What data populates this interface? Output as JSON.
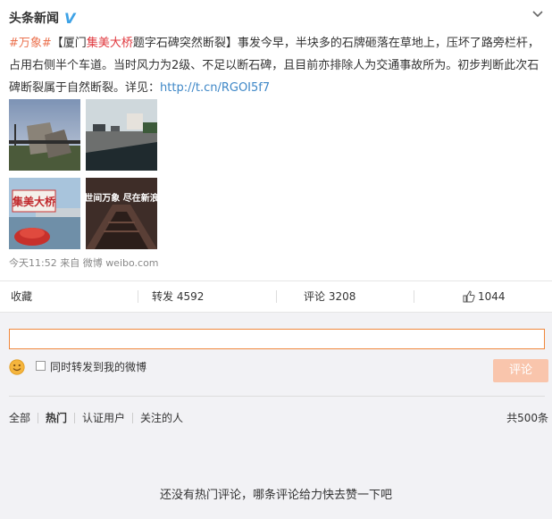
{
  "post": {
    "author": "头条新闻",
    "verified_badge": "V",
    "text_parts": [
      {
        "text": "#万象#",
        "style": "tag"
      },
      {
        "text": "【厦门",
        "style": "plain"
      },
      {
        "text": "集美大桥",
        "style": "hl"
      },
      {
        "text": "题字石碑突然断裂】事发今早，半块多的石牌砸落在草地上，压坏了路旁栏杆，占用右侧半个车道。当时风力为2级、不足以断石碑，且目前亦排除人为交通事故所为。初步判断此次石碑断裂属于自然断裂。详见：",
        "style": "plain"
      },
      {
        "text": "http://t.cn/RGOI5f7",
        "style": "link"
      }
    ],
    "images": [
      {
        "name": "photo-broken-stone-tablet",
        "icon": "photo"
      },
      {
        "name": "photo-road-view-from-car",
        "icon": "photo"
      },
      {
        "name": "photo-bridge-sign",
        "icon": "photo",
        "caption": "集美大桥"
      },
      {
        "name": "photo-wanxiang-poster",
        "icon": "photo",
        "caption": "世间万象 尽在新浪"
      }
    ],
    "meta": "今天11:52 来自 微博 weibo.com"
  },
  "actions": {
    "favorite": "收藏",
    "repost": "转发 4592",
    "comment": "评论 3208",
    "like": "1044"
  },
  "comment_box": {
    "input_value": "",
    "placeholder": "",
    "repost_checkbox_label": "同时转发到我的微博",
    "submit_label": "评论"
  },
  "filters": {
    "items": [
      "全部",
      "热门",
      "认证用户",
      "关注的人"
    ],
    "active": "热门",
    "total": "共500条"
  },
  "empty_message": "还没有热门评论，哪条评论给力快去赞一下吧",
  "colors": {
    "tag": "#eb7350",
    "highlight": "#e0383e",
    "link": "#3e87c7",
    "input_border": "#f0873c",
    "submit_bg": "#f9c5ac"
  }
}
